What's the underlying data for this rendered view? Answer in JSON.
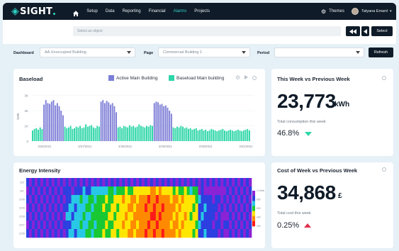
{
  "app": {
    "logo_text": "SIGHT",
    "nav": [
      "Setup",
      "Data",
      "Reporting",
      "Financial",
      "Alarms",
      "Projects"
    ],
    "active_nav": "Alarms",
    "themes_label": "Themes",
    "user_name": "Tatyana Emard"
  },
  "toolbar": {
    "select_object_placeholder": "Select an object",
    "select_button": "Select"
  },
  "filters": {
    "dashboard_label": "Dashboard",
    "dashboard_value": "AA Unoccupied Building",
    "page_label": "Page",
    "page_value": "Commercial Building 1",
    "period_label": "Period",
    "period_value": "",
    "refresh_button": "Refresh"
  },
  "baseload": {
    "title": "Baseload",
    "legend": [
      "Active Main Building",
      "Baseload Main building"
    ],
    "colors": {
      "active": "#8080d8",
      "baseload": "#2ed6a8"
    }
  },
  "week_compare": {
    "title": "This Week vs Previous Week",
    "value": "23,773",
    "unit": "kWh",
    "caption": "Total consumption this week",
    "percent": "46.8%",
    "trend": "down",
    "trend_color": "#2ed6a8"
  },
  "energy_intensity": {
    "title": "Energy Intensity"
  },
  "cost_compare": {
    "title": "Cost of Week vs Previous Week",
    "value": "34,868",
    "unit": "£",
    "caption": "Total cost this week",
    "percent": "0.25%",
    "trend": "up",
    "trend_color": "#e0314b"
  },
  "chart_data": [
    {
      "type": "bar",
      "title": "Baseload",
      "ylabel": "kWh",
      "y_ticks": [
        "3K",
        "2K",
        "1K",
        "0"
      ],
      "ylim": [
        0,
        3500
      ],
      "x_tick_labels": [
        "2/26/2021",
        "2/27/2021",
        "2/28/2021",
        "2/29/2021",
        "2/30/2021",
        "2/31/2021"
      ],
      "series": [
        {
          "name": "Active Main Building",
          "values": [
            0,
            0,
            0,
            0,
            0,
            0,
            2400,
            2700,
            2500,
            2450,
            2600,
            2700,
            2350,
            2500,
            2300,
            2000,
            1700,
            0,
            0,
            0,
            0,
            0,
            0,
            0,
            0,
            0,
            0,
            0,
            0,
            0,
            0,
            0,
            0,
            0,
            0,
            0,
            2600,
            2700,
            2500,
            2650,
            2550,
            2400,
            2500,
            2300,
            1900,
            0,
            0,
            0,
            0,
            0,
            0,
            0,
            0,
            0,
            0,
            0,
            0,
            0,
            0,
            0,
            0,
            0,
            0,
            0,
            2500,
            2600,
            2550,
            2400,
            2450,
            2300,
            2350,
            2200,
            2000,
            1800,
            0,
            0,
            0,
            0,
            0,
            0,
            0,
            0,
            0,
            0,
            0,
            0,
            0,
            0,
            0,
            0,
            0,
            0,
            0,
            0,
            0,
            0,
            0,
            0,
            0,
            0,
            0,
            0,
            0,
            0,
            0,
            0,
            0,
            0,
            0,
            0,
            0,
            0,
            0,
            0,
            0,
            0,
            0
          ]
        },
        {
          "name": "Baseload Main building",
          "values": [
            700,
            800,
            850,
            750,
            900,
            800,
            0,
            0,
            0,
            0,
            0,
            0,
            0,
            0,
            0,
            0,
            0,
            950,
            850,
            900,
            1000,
            800,
            850,
            950,
            900,
            1000,
            850,
            900,
            1100,
            950,
            1000,
            1050,
            900,
            850,
            1000,
            950,
            0,
            0,
            0,
            0,
            0,
            0,
            0,
            0,
            0,
            900,
            950,
            850,
            1000,
            950,
            900,
            1050,
            950,
            1000,
            900,
            950,
            1100,
            1000,
            950,
            900,
            1000,
            950,
            1050,
            1000,
            0,
            0,
            0,
            0,
            0,
            0,
            0,
            0,
            0,
            0,
            900,
            850,
            950,
            900,
            1000,
            950,
            850,
            900,
            800,
            850,
            750,
            800,
            850,
            700,
            750,
            800,
            700,
            750,
            650,
            700,
            800,
            750,
            700,
            650,
            700,
            750,
            800,
            700,
            650,
            700,
            750,
            700,
            650,
            700,
            750,
            700,
            650,
            700,
            750,
            800,
            700
          ]
        }
      ]
    },
    {
      "type": "heatmap",
      "title": "Energy Intensity",
      "y_tick_labels": [
        "3/2",
        "3/1",
        "2/30",
        "2/29",
        "2/28",
        "2/27",
        "2/26"
      ],
      "colorbar_labels": [
        "1.1Kwh",
        "800",
        "600",
        "400",
        "200"
      ]
    }
  ]
}
